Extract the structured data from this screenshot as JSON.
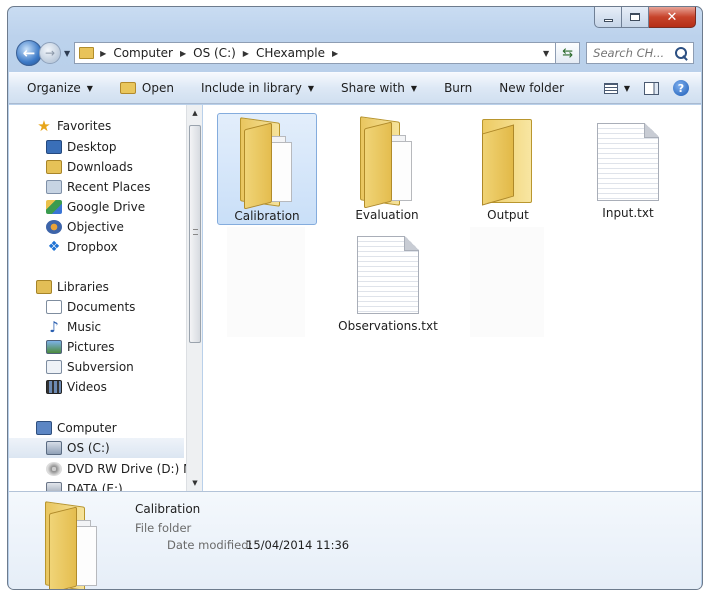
{
  "window": {
    "caption_buttons": {
      "minimize": "minimize-icon",
      "maximize": "maximize-icon",
      "close": "close-icon"
    }
  },
  "address": {
    "crumbs": [
      "Computer",
      "OS (C:)",
      "CHexample"
    ],
    "search_placeholder": "Search CH..."
  },
  "toolbar": {
    "organize": "Organize",
    "open": "Open",
    "include_in_library": "Include in library",
    "share_with": "Share with",
    "burn": "Burn",
    "new_folder": "New folder"
  },
  "sidebar": {
    "favorites": {
      "label": "Favorites",
      "items": [
        "Desktop",
        "Downloads",
        "Recent Places",
        "Google Drive",
        "Objective",
        "Dropbox"
      ]
    },
    "libraries": {
      "label": "Libraries",
      "items": [
        "Documents",
        "Music",
        "Pictures",
        "Subversion",
        "Videos"
      ]
    },
    "computer": {
      "label": "Computer",
      "items": [
        "OS (C:)",
        "DVD RW Drive (D:) Ma",
        "DATA (E:)"
      ],
      "selected": "OS (C:)"
    }
  },
  "files": [
    {
      "name": "Calibration",
      "type": "folder-with-files",
      "selected": true
    },
    {
      "name": "Evaluation",
      "type": "folder-with-files",
      "selected": false
    },
    {
      "name": "Output",
      "type": "folder",
      "selected": false
    },
    {
      "name": "Input.txt",
      "type": "text-file",
      "selected": false
    },
    {
      "name": "Observations.txt",
      "type": "text-file",
      "selected": false
    }
  ],
  "details": {
    "name": "Calibration",
    "type": "File folder",
    "date_label": "Date modified:",
    "date_value": "15/04/2014 11:36"
  },
  "colors": {
    "selection": "#c9dff8",
    "selection_border": "#84acdd",
    "chrome": "#bcd2ec",
    "folder": "#e9c65f"
  }
}
